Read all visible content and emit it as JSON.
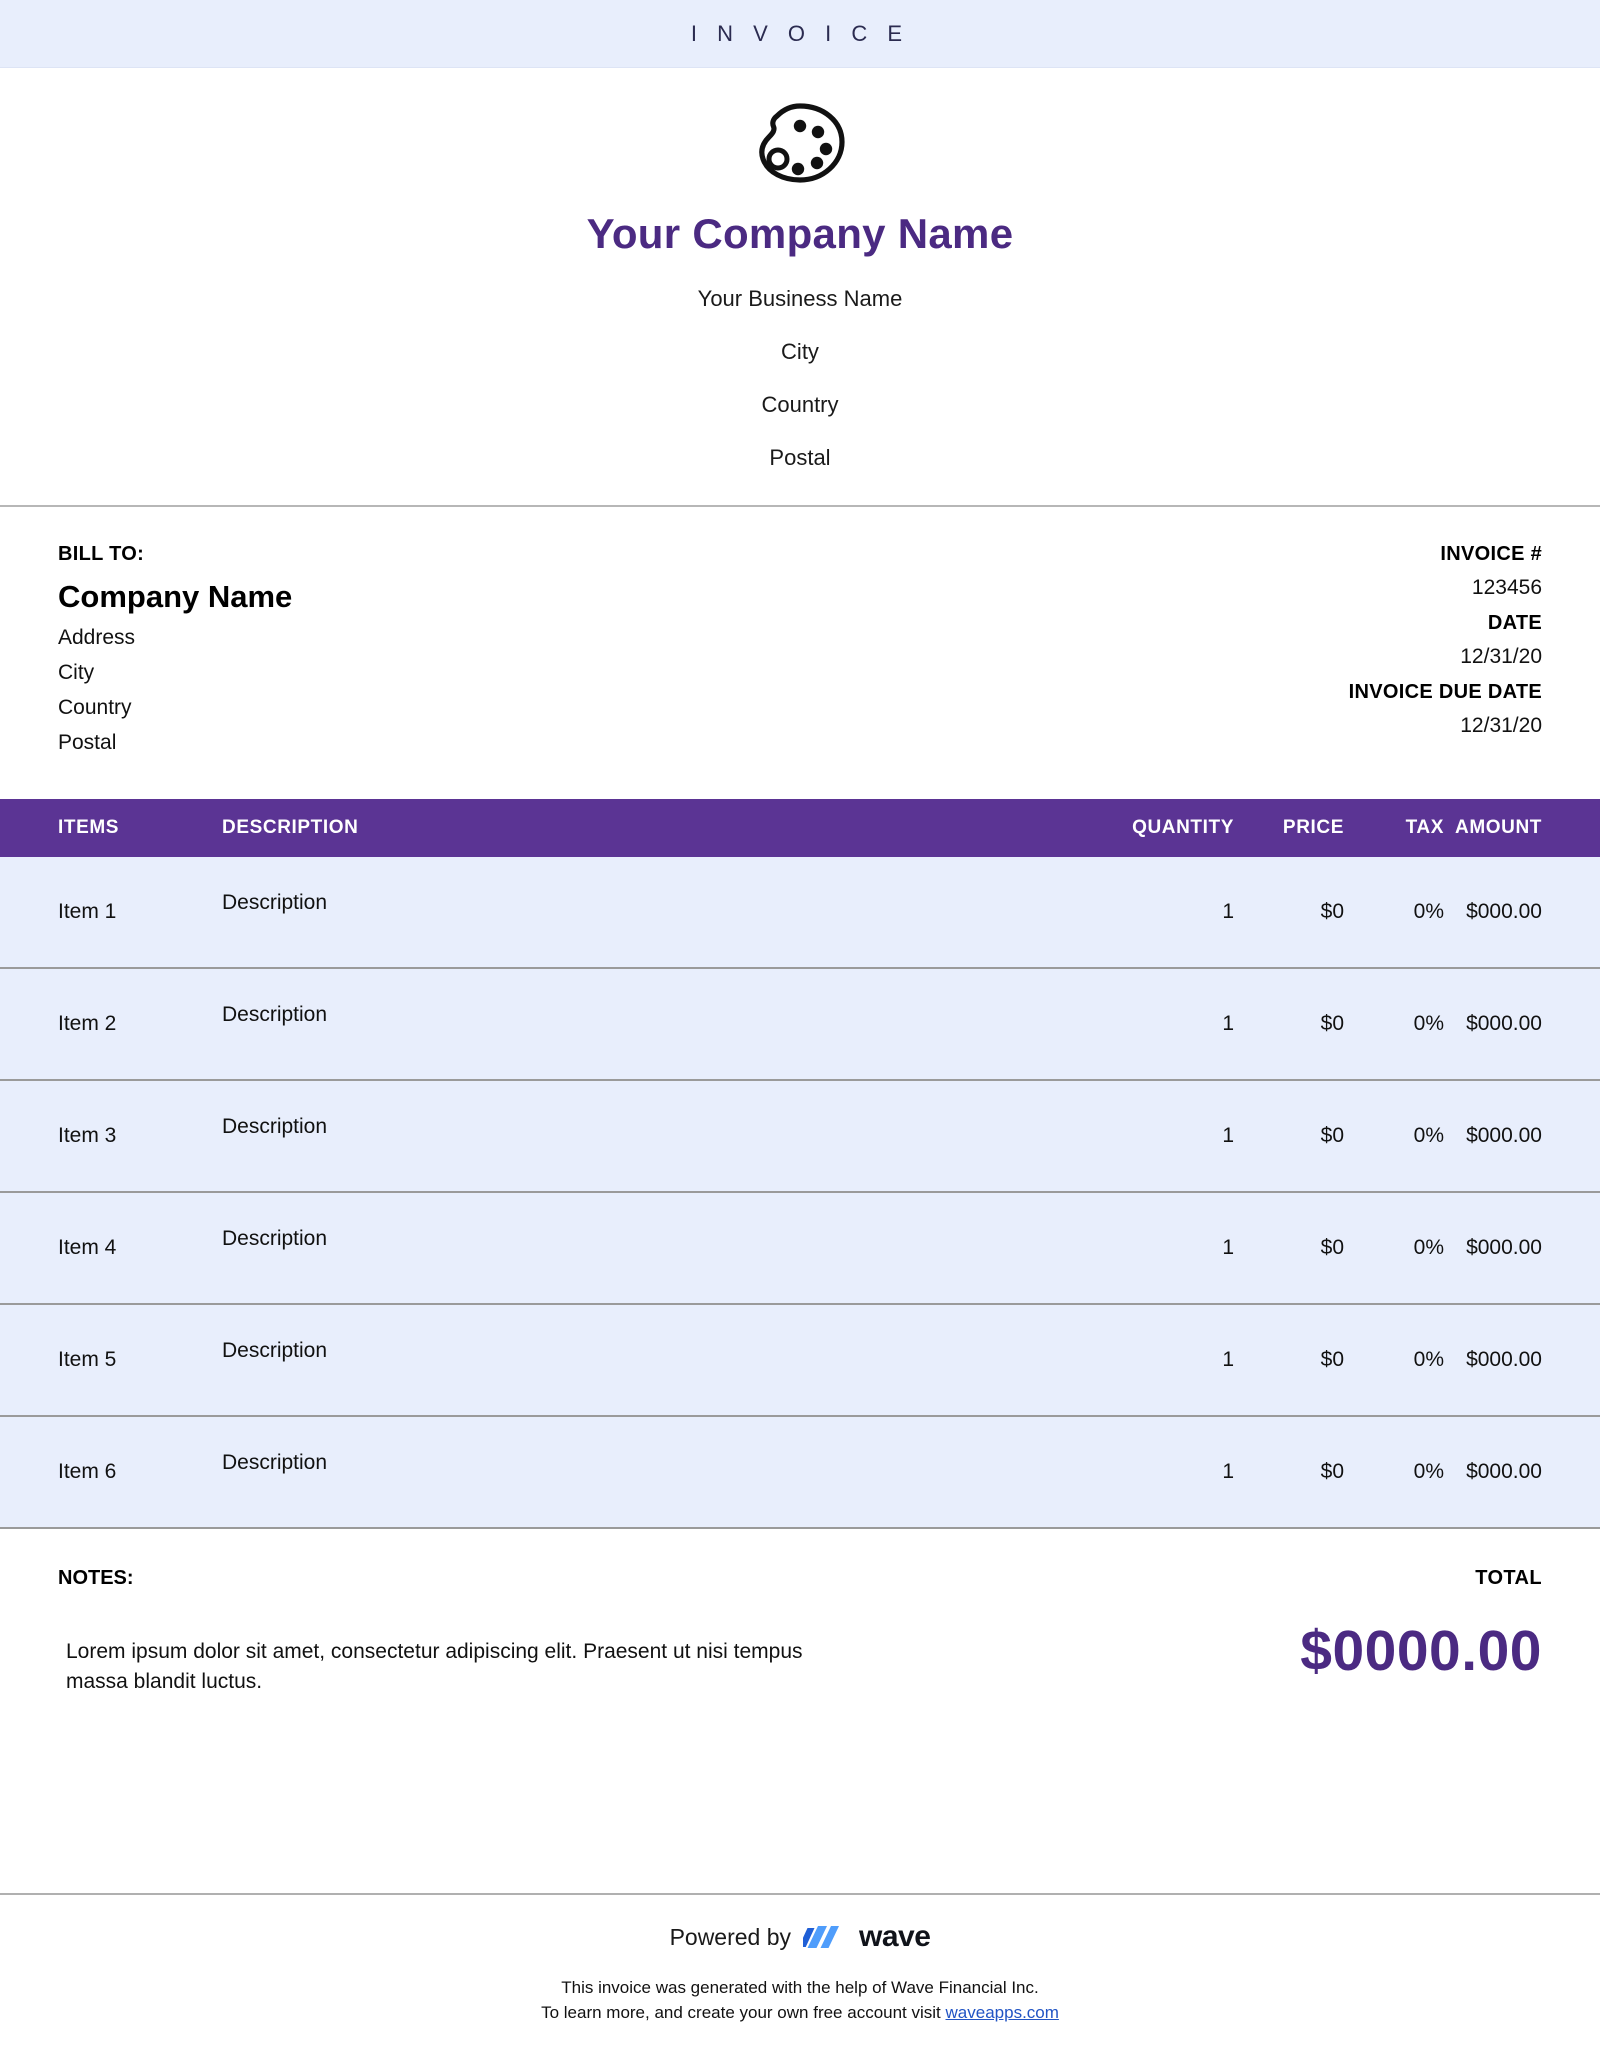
{
  "banner": {
    "title": "I N V O I C E"
  },
  "colors": {
    "accent_purple": "#4b2a82",
    "table_header_purple": "#5b3494",
    "row_background": "#e8eefc",
    "banner_background": "#e8eefc",
    "link_blue": "#2154c4"
  },
  "masthead": {
    "logo_icon": "palette-icon",
    "company_name": "Your Company Name",
    "address_lines": [
      "Your Business Name",
      "City",
      "Country",
      "Postal"
    ]
  },
  "bill_to": {
    "label": "BILL TO:",
    "company": "Company Name",
    "lines": [
      "Address",
      "City",
      "Country",
      "Postal"
    ]
  },
  "invoice_meta": [
    {
      "label": "INVOICE #",
      "value": "123456"
    },
    {
      "label": "DATE",
      "value": "12/31/20"
    },
    {
      "label": "INVOICE DUE DATE",
      "value": "12/31/20"
    }
  ],
  "items_table": {
    "headers": {
      "items": "ITEMS",
      "description": "DESCRIPTION",
      "quantity": "QUANTITY",
      "price": "PRICE",
      "tax": "TAX",
      "amount": "AMOUNT"
    },
    "rows": [
      {
        "item": "Item 1",
        "description": "Description",
        "quantity": "1",
        "price": "$0",
        "tax": "0%",
        "amount": "$000.00"
      },
      {
        "item": "Item 2",
        "description": "Description",
        "quantity": "1",
        "price": "$0",
        "tax": "0%",
        "amount": "$000.00"
      },
      {
        "item": "Item 3",
        "description": "Description",
        "quantity": "1",
        "price": "$0",
        "tax": "0%",
        "amount": "$000.00"
      },
      {
        "item": "Item 4",
        "description": "Description",
        "quantity": "1",
        "price": "$0",
        "tax": "0%",
        "amount": "$000.00"
      },
      {
        "item": "Item 5",
        "description": "Description",
        "quantity": "1",
        "price": "$0",
        "tax": "0%",
        "amount": "$000.00"
      },
      {
        "item": "Item 6",
        "description": "Description",
        "quantity": "1",
        "price": "$0",
        "tax": "0%",
        "amount": "$000.00"
      }
    ]
  },
  "notes": {
    "label": "NOTES:",
    "body": "Lorem ipsum dolor sit amet, consectetur adipiscing elit. Praesent ut nisi tempus massa blandit luctus."
  },
  "total": {
    "label": "TOTAL",
    "amount": "$0000.00"
  },
  "footer": {
    "powered_by": "Powered by",
    "brand": "wave",
    "brand_icon": "wave-logo-icon",
    "note_line_1": "This invoice was generated with the help of Wave Financial Inc.",
    "note_line_2_prefix": "To learn more, and create your own free account visit ",
    "link_text": "waveapps.com"
  }
}
